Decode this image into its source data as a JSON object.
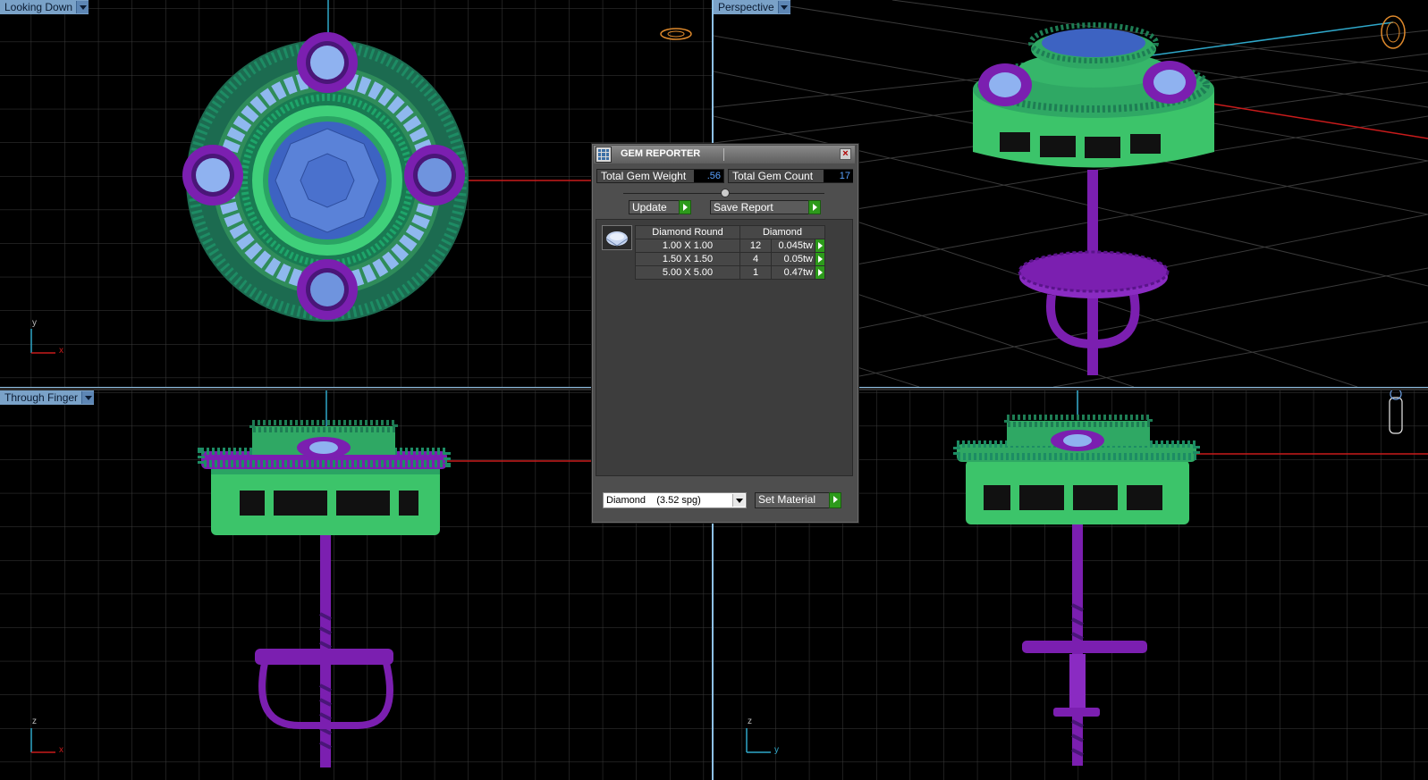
{
  "viewports": {
    "top_left": {
      "label": "Looking Down",
      "axis_a": "y",
      "axis_b": "x"
    },
    "top_right": {
      "label": "Perspective"
    },
    "bottom_left": {
      "label": "Through Finger",
      "axis_a": "z",
      "axis_b": "x"
    },
    "bottom_right": {
      "label": "",
      "axis_a": "z",
      "axis_b": "y"
    }
  },
  "gem_reporter": {
    "title": "GEM REPORTER",
    "close": "×",
    "total_weight_label": "Total Gem Weight",
    "total_weight_value": ".56",
    "total_count_label": "Total Gem Count",
    "total_count_value": "17",
    "update_label": "Update",
    "save_label": "Save Report",
    "table_headers": [
      "Diamond Round",
      "Diamond"
    ],
    "rows": [
      {
        "size": "1.00 X 1.00",
        "count": "12",
        "weight": "0.045tw"
      },
      {
        "size": "1.50 X 1.50",
        "count": "4",
        "weight": "0.05tw"
      },
      {
        "size": "5.00 X 5.00",
        "count": "1",
        "weight": "0.47tw"
      }
    ],
    "material_value": "Diamond    (3.52 spg)",
    "set_material_label": "Set Material"
  },
  "colors": {
    "metal_green": "#3cc46a",
    "metal_purple": "#7b1fb0",
    "gem_blue": "#3d63c2",
    "accent_label": "#7aa2c8"
  }
}
